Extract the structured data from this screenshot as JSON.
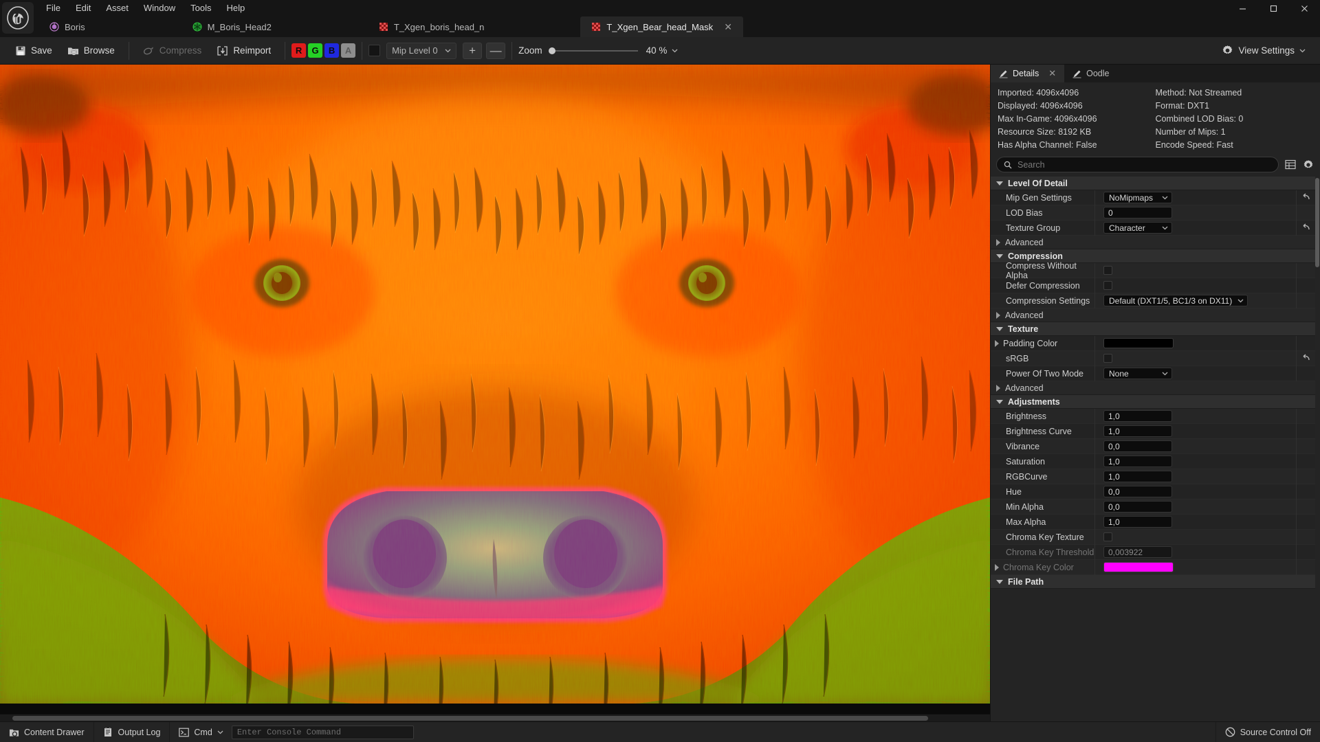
{
  "window": {
    "menu": [
      "File",
      "Edit",
      "Asset",
      "Window",
      "Tools",
      "Help"
    ],
    "controls": {
      "minimize": "minimize-icon",
      "maximize": "maximize-icon",
      "close": "close-icon"
    }
  },
  "tabs": [
    {
      "label": "Boris",
      "icon": "blueprint-icon",
      "active": false,
      "closable": false
    },
    {
      "label": "M_Boris_Head2",
      "icon": "material-icon",
      "active": false,
      "closable": false
    },
    {
      "label": "T_Xgen_boris_head_n",
      "icon": "texture-icon",
      "active": false,
      "closable": false
    },
    {
      "label": "T_Xgen_Bear_head_Mask",
      "icon": "texture-icon",
      "active": true,
      "closable": true
    }
  ],
  "toolbar": {
    "save_label": "Save",
    "browse_label": "Browse",
    "compress_label": "Compress",
    "reimport_label": "Reimport",
    "channels": [
      "R",
      "G",
      "B",
      "A"
    ],
    "mip_level": "Mip Level 0",
    "plus_label": "+",
    "minus_label": "—",
    "zoom_label": "Zoom",
    "zoom_value": "40 %",
    "view_settings_label": "View Settings"
  },
  "details_panel": {
    "tabs": [
      {
        "label": "Details",
        "icon": "details-icon",
        "active": true,
        "closable": true
      },
      {
        "label": "Oodle",
        "icon": "details-icon",
        "active": false,
        "closable": false
      }
    ],
    "info": [
      "Imported: 4096x4096",
      "Method: Not Streamed",
      "Displayed: 4096x4096",
      "Format: DXT1",
      "Max In-Game: 4096x4096",
      "Combined LOD Bias: 0",
      "Resource Size: 8192 KB",
      "Number of Mips: 1",
      "Has Alpha Channel: False",
      "Encode Speed: Fast"
    ],
    "search_placeholder": "Search",
    "search_value": "",
    "sections": [
      {
        "name": "Level Of Detail",
        "expanded": true,
        "rows": [
          {
            "label": "Mip Gen Settings",
            "type": "dropdown",
            "value": "NoMipmaps",
            "reset": true,
            "tri": false,
            "dim": false
          },
          {
            "label": "LOD Bias",
            "type": "text",
            "value": "0",
            "reset": false,
            "tri": false,
            "dim": false
          },
          {
            "label": "Texture Group",
            "type": "dropdown",
            "value": "Character",
            "reset": true,
            "tri": false,
            "dim": false
          }
        ],
        "advanced": "Advanced"
      },
      {
        "name": "Compression",
        "expanded": true,
        "rows": [
          {
            "label": "Compress Without Alpha",
            "type": "checkbox",
            "value": "",
            "reset": false,
            "tri": false,
            "dim": false
          },
          {
            "label": "Defer Compression",
            "type": "checkbox",
            "value": "",
            "reset": false,
            "tri": false,
            "dim": false
          },
          {
            "label": "Compression Settings",
            "type": "dropdown-wide",
            "value": "Default (DXT1/5, BC1/3 on DX11)",
            "reset": false,
            "tri": false,
            "dim": false
          }
        ],
        "advanced": "Advanced"
      },
      {
        "name": "Texture",
        "expanded": true,
        "rows": [
          {
            "label": "Padding Color",
            "type": "color",
            "value": "#000000",
            "reset": false,
            "tri": true,
            "dim": false
          },
          {
            "label": "sRGB",
            "type": "checkbox",
            "value": "",
            "reset": true,
            "tri": false,
            "dim": false
          },
          {
            "label": "Power Of Two Mode",
            "type": "dropdown",
            "value": "None",
            "reset": false,
            "tri": false,
            "dim": false
          }
        ],
        "advanced": "Advanced"
      },
      {
        "name": "Adjustments",
        "expanded": true,
        "rows": [
          {
            "label": "Brightness",
            "type": "text",
            "value": "1,0",
            "reset": false,
            "tri": false,
            "dim": false
          },
          {
            "label": "Brightness Curve",
            "type": "text",
            "value": "1,0",
            "reset": false,
            "tri": false,
            "dim": false
          },
          {
            "label": "Vibrance",
            "type": "text",
            "value": "0,0",
            "reset": false,
            "tri": false,
            "dim": false
          },
          {
            "label": "Saturation",
            "type": "text",
            "value": "1,0",
            "reset": false,
            "tri": false,
            "dim": false
          },
          {
            "label": "RGBCurve",
            "type": "text",
            "value": "1,0",
            "reset": false,
            "tri": false,
            "dim": false
          },
          {
            "label": "Hue",
            "type": "text",
            "value": "0,0",
            "reset": false,
            "tri": false,
            "dim": false
          },
          {
            "label": "Min Alpha",
            "type": "text",
            "value": "0,0",
            "reset": false,
            "tri": false,
            "dim": false
          },
          {
            "label": "Max Alpha",
            "type": "text",
            "value": "1,0",
            "reset": false,
            "tri": false,
            "dim": false
          },
          {
            "label": "Chroma Key Texture",
            "type": "checkbox",
            "value": "",
            "reset": false,
            "tri": false,
            "dim": false
          },
          {
            "label": "Chroma Key Threshold",
            "type": "text-dim",
            "value": "0,003922",
            "reset": false,
            "tri": false,
            "dim": true
          },
          {
            "label": "Chroma Key Color",
            "type": "color",
            "value": "#FF00FF",
            "reset": false,
            "tri": true,
            "dim": true
          }
        ],
        "advanced": null
      },
      {
        "name": "File Path",
        "expanded": true,
        "rows": [],
        "advanced": null
      }
    ]
  },
  "statusbar": {
    "content_drawer": "Content Drawer",
    "output_log": "Output Log",
    "cmd": "Cmd",
    "console_placeholder": "Enter Console Command",
    "console_value": "",
    "source_control": "Source Control Off"
  },
  "colors": {
    "accent_red": "#e01b1b",
    "accent_green": "#25d025",
    "accent_blue": "#1f29e0",
    "accent_gray": "#8e8e8e",
    "chroma_key": "#FF00FF"
  }
}
